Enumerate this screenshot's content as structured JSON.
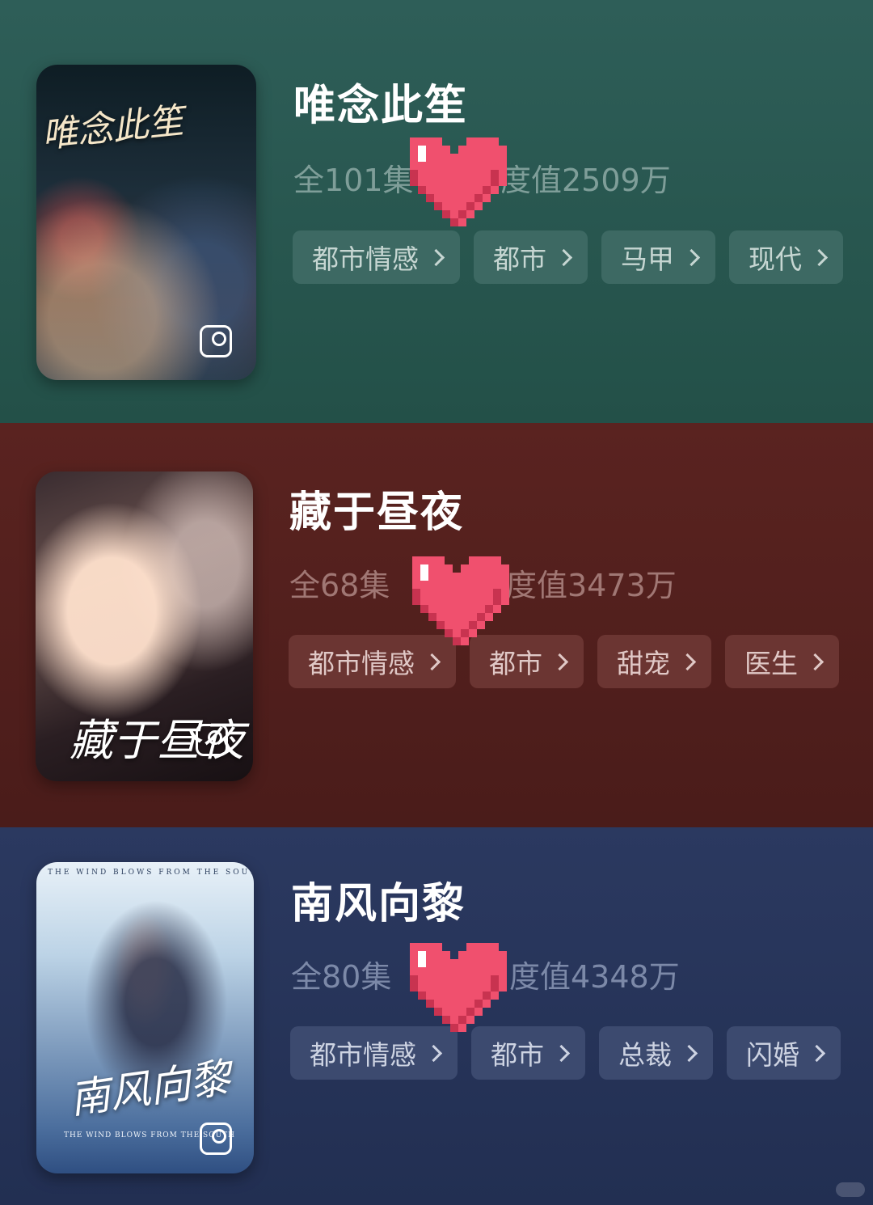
{
  "dramas": [
    {
      "title": "唯念此笙",
      "episodes": "全101集",
      "heat": "热度值2509万",
      "poster_title": "唯念此笙",
      "tags": [
        "都市情感",
        "都市",
        "马甲",
        "现代"
      ]
    },
    {
      "title": "藏于昼夜",
      "episodes": "全68集",
      "heat": "热度值3473万",
      "poster_title": "藏于昼夜",
      "tags": [
        "都市情感",
        "都市",
        "甜宠",
        "医生"
      ]
    },
    {
      "title": "南风向黎",
      "episodes": "全80集",
      "heat": "热度值4348万",
      "poster_title": "南风向黎",
      "poster_tagline": "THE WIND BLOWS FROM THE SOUTH",
      "poster_subtitle": "THE WIND BLOWS FROM THE SOUTH",
      "tags": [
        "都市情感",
        "都市",
        "总裁",
        "闪婚"
      ]
    }
  ],
  "colors": {
    "section_1": "#2e5e58",
    "section_2": "#5a2320",
    "section_3": "#2b3960",
    "heart": "#f0506e"
  },
  "icons": {
    "collect": "collect-icon",
    "chevron": "chevron-right-icon",
    "heart": "pixel-heart-icon"
  }
}
